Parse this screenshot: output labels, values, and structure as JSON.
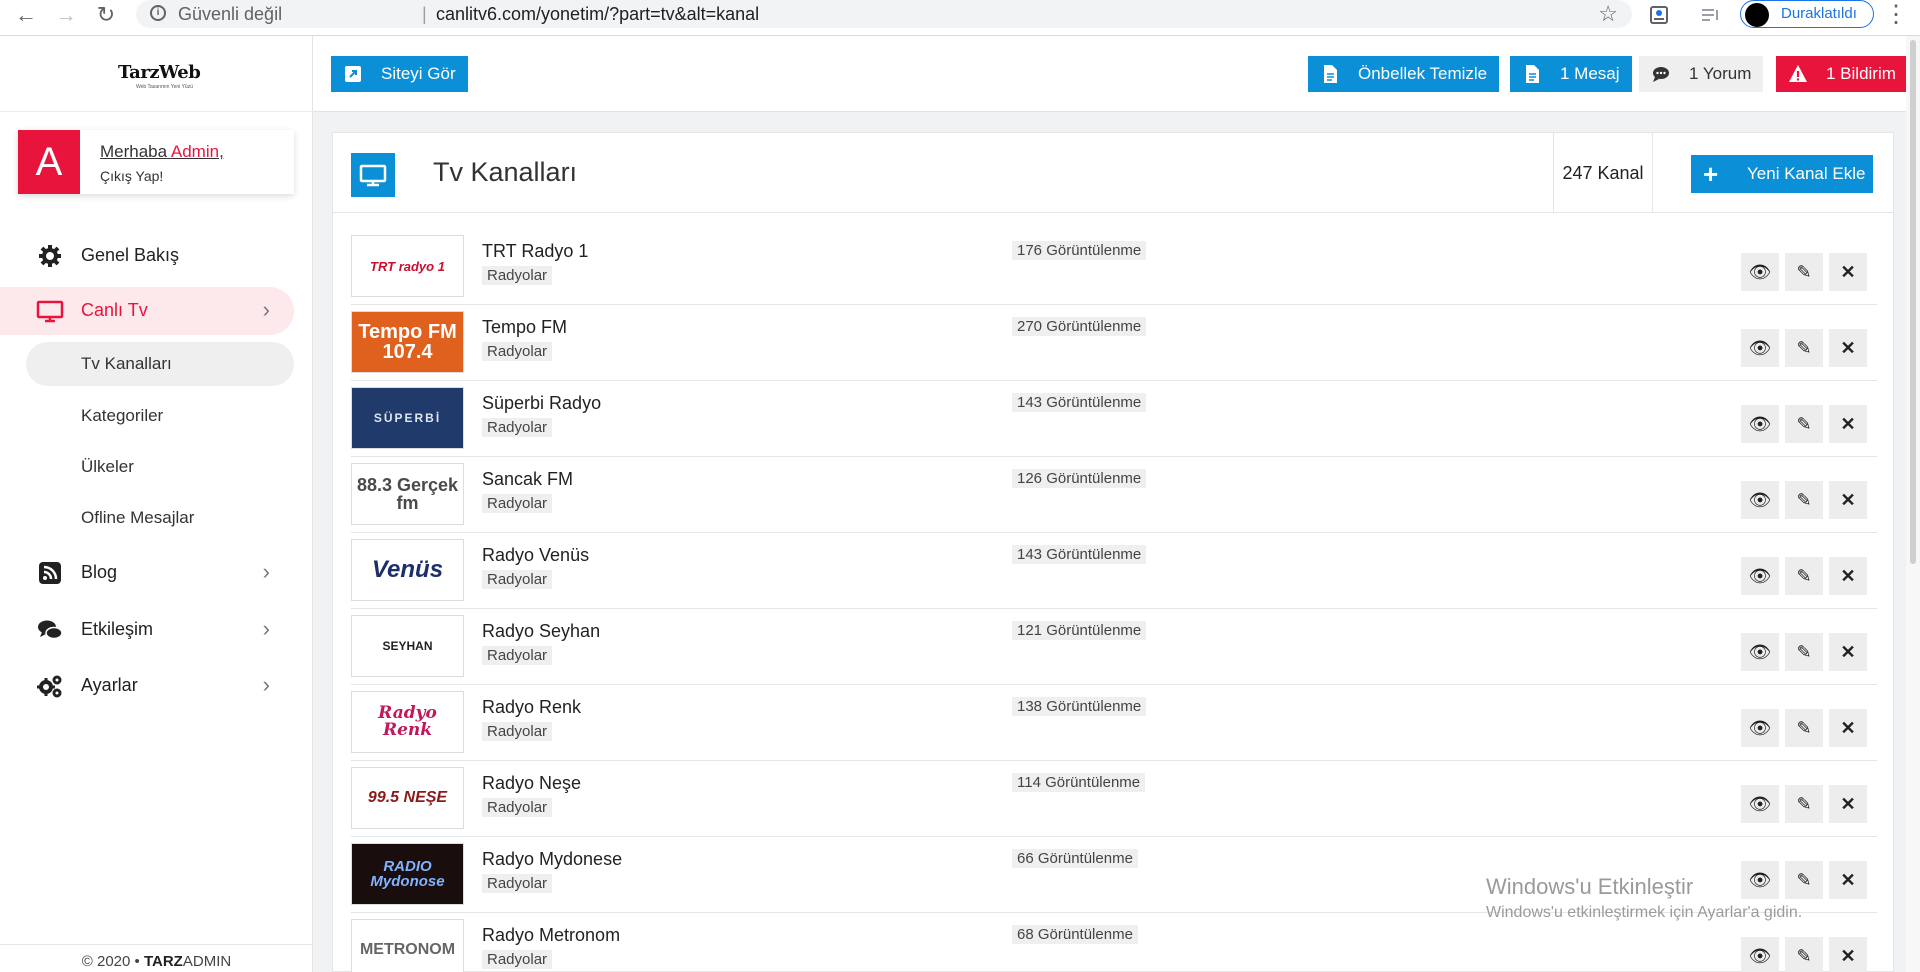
{
  "browser": {
    "insecure_label": "Güvenli değil",
    "separator": "|",
    "url": "canlitv6.com/yonetim/?part=tv&alt=kanal",
    "profile_label": "Duraklatıldı"
  },
  "sidebar": {
    "logo_text": "TarzWeb",
    "logo_sub": "Web Tasarımın Yeni Yüzü",
    "user": {
      "avatar_letter": "A",
      "greeting": "Merhaba ",
      "name": "Admin",
      "comma": ",",
      "logout": "Çıkış Yap!"
    },
    "menu": [
      {
        "label": "Genel Bakış",
        "icon": "cogs-icon"
      },
      {
        "label": "Canlı Tv",
        "icon": "monitor-icon"
      },
      {
        "label": "Blog",
        "icon": "rss-icon"
      },
      {
        "label": "Etkileşim",
        "icon": "comments-icon"
      },
      {
        "label": "Ayarlar",
        "icon": "settings-icon"
      }
    ],
    "submenu": [
      {
        "label": "Tv Kanalları"
      },
      {
        "label": "Kategoriler"
      },
      {
        "label": "Ülkeler"
      },
      {
        "label": "Ofline Mesajlar"
      }
    ],
    "footer": {
      "copy": "© 2020 • ",
      "brand1": "TARZ",
      "brand2": "ADMIN"
    }
  },
  "topbar": {
    "site_button": "Siteyi Gör",
    "cache_button": "Önbellek Temizle",
    "message_button": "1 Mesaj",
    "comment_button": "1 Yorum",
    "notification_button": "1 Bildirim"
  },
  "panel": {
    "title": "Tv Kanalları",
    "count": "247 Kanal",
    "new_button": "Yeni Kanal Ekle"
  },
  "channels": [
    {
      "name": "TRT Radyo 1",
      "category": "Radyolar",
      "views": "176 Görüntülenme",
      "logo_text": "TRT radyo 1"
    },
    {
      "name": "Tempo FM",
      "category": "Radyolar",
      "views": "270 Görüntülenme",
      "logo_text": "Tempo FM 107.4"
    },
    {
      "name": "Süperbi Radyo",
      "category": "Radyolar",
      "views": "143 Görüntülenme",
      "logo_text": "SÜPERBİ"
    },
    {
      "name": "Sancak FM",
      "category": "Radyolar",
      "views": "126 Görüntülenme",
      "logo_text": "88.3 Gerçek fm"
    },
    {
      "name": "Radyo Venüs",
      "category": "Radyolar",
      "views": "143 Görüntülenme",
      "logo_text": "Venüs"
    },
    {
      "name": "Radyo Seyhan",
      "category": "Radyolar",
      "views": "121 Görüntülenme",
      "logo_text": "SEYHAN"
    },
    {
      "name": "Radyo Renk",
      "category": "Radyolar",
      "views": "138 Görüntülenme",
      "logo_text": "Radyo Renk"
    },
    {
      "name": "Radyo Neşe",
      "category": "Radyolar",
      "views": "114 Görüntülenme",
      "logo_text": "99.5 NEŞE"
    },
    {
      "name": "Radyo Mydonese",
      "category": "Radyolar",
      "views": "66 Görüntülenme",
      "logo_text": "RADIO Mydonose"
    },
    {
      "name": "Radyo Metronom",
      "category": "Radyolar",
      "views": "68 Görüntülenme",
      "logo_text": "METRONOM"
    }
  ],
  "watermark": {
    "line1": "Windows'u Etkinleştir",
    "line2": "Windows'u etkinleştirmek için Ayarlar'a gidin."
  },
  "colors": {
    "accent": "#0b8fd6",
    "danger": "#e8143c"
  }
}
